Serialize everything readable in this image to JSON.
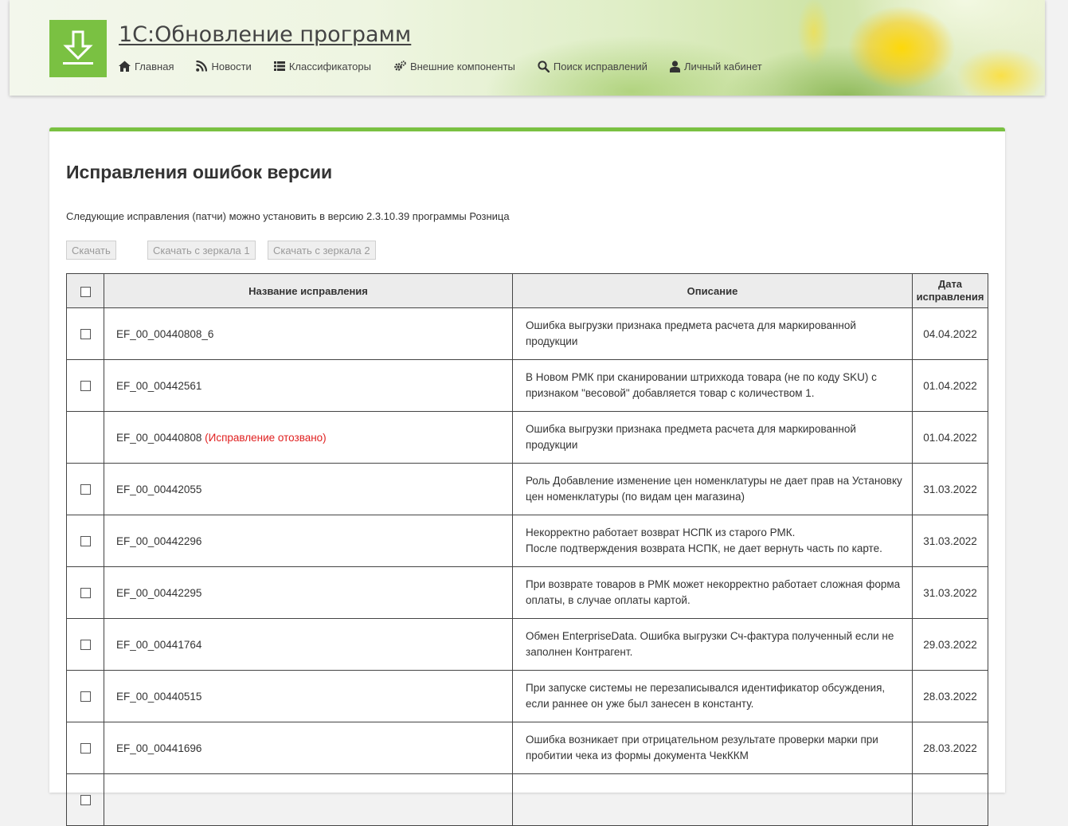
{
  "header": {
    "title": "1С:Обновление программ",
    "logo_icon": "download-icon",
    "accent_color": "#7ac142",
    "nav": [
      {
        "label": "Главная",
        "icon": "home-icon"
      },
      {
        "label": "Новости",
        "icon": "rss-icon"
      },
      {
        "label": "Классификаторы",
        "icon": "list-icon"
      },
      {
        "label": "Внешние компоненты",
        "icon": "gears-icon"
      },
      {
        "label": "Поиск исправлений",
        "icon": "search-icon"
      },
      {
        "label": "Личный кабинет",
        "icon": "user-icon"
      }
    ]
  },
  "main": {
    "title": "Исправления ошибок версии",
    "subtitle": "Следующие исправления (патчи) можно установить в версию 2.3.10.39 программы Розница",
    "buttons": {
      "download": "Скачать",
      "mirror1": "Скачать с зеркала 1",
      "mirror2": "Скачать с зеркала 2"
    },
    "table": {
      "headers": {
        "name": "Название исправления",
        "description": "Описание",
        "date": "Дата исправления"
      },
      "rows": [
        {
          "name": "EF_00_00440808_6",
          "note": "",
          "checkbox": true,
          "description": "Ошибка выгрузки признака предмета расчета для маркированной продукции",
          "date": "04.04.2022"
        },
        {
          "name": "EF_00_00442561",
          "note": "",
          "checkbox": true,
          "description": "В Новом РМК при сканировании штрихкода товара (не по коду SKU) с признаком \"весовой\" добавляется товар с количеством 1.",
          "date": "01.04.2022"
        },
        {
          "name": "EF_00_00440808",
          "note": "(Исправление отозвано)",
          "checkbox": false,
          "description": "Ошибка выгрузки признака предмета расчета для маркированной продукции",
          "date": "01.04.2022"
        },
        {
          "name": "EF_00_00442055",
          "note": "",
          "checkbox": true,
          "description": "Роль Добавление изменение цен номенклатуры не дает прав на Установку цен номенклатуры (по видам цен магазина)",
          "date": "31.03.2022"
        },
        {
          "name": "EF_00_00442296",
          "note": "",
          "checkbox": true,
          "description": "Некорректно работает возврат НСПК из старого РМК.\nПосле подтверждения возврата НСПК, не дает вернуть часть по карте.",
          "date": "31.03.2022"
        },
        {
          "name": "EF_00_00442295",
          "note": "",
          "checkbox": true,
          "description": "При возврате товаров в РМК может некорректно работает сложная форма оплаты, в случае оплаты картой.",
          "date": "31.03.2022"
        },
        {
          "name": "EF_00_00441764",
          "note": "",
          "checkbox": true,
          "description": "Обмен EnterpriseData. Ошибка выгрузки Сч-фактура полученный если не заполнен Контрагент.",
          "date": "29.03.2022"
        },
        {
          "name": "EF_00_00440515",
          "note": "",
          "checkbox": true,
          "description": "При запуске системы не перезаписывался идентификатор обсуждения, если раннее он уже был занесен в константу.",
          "date": "28.03.2022"
        },
        {
          "name": "EF_00_00441696",
          "note": "",
          "checkbox": true,
          "description": "Ошибка возникает при отрицательном результате проверки марки при пробитии чека из формы документа ЧекККМ",
          "date": "28.03.2022"
        },
        {
          "name": "",
          "note": "",
          "checkbox": true,
          "description": "",
          "date": ""
        }
      ]
    }
  }
}
